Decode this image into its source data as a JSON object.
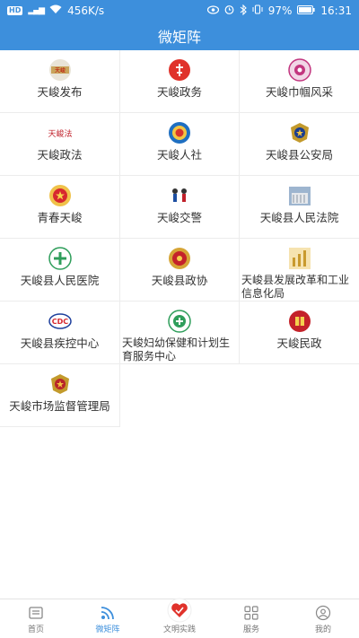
{
  "status": {
    "speed": "456K/s",
    "battery": "97%",
    "time": "16:31",
    "hd": "HD",
    "signal": "⁴ᴳ"
  },
  "header": {
    "title": "微矩阵"
  },
  "grid": [
    {
      "label": "天峻发布",
      "icon": "tianjun-fabu-logo"
    },
    {
      "label": "天峻政务",
      "icon": "zhengwu-logo"
    },
    {
      "label": "天峻巾帼风采",
      "icon": "women-federation-logo"
    },
    {
      "label": "天峻政法",
      "icon": "zhengfa-logo"
    },
    {
      "label": "天峻人社",
      "icon": "renshe-logo"
    },
    {
      "label": "天峻县公安局",
      "icon": "police-badge-logo"
    },
    {
      "label": "青春天峻",
      "icon": "youth-league-logo"
    },
    {
      "label": "天峻交警",
      "icon": "traffic-police-logo"
    },
    {
      "label": "天峻县人民法院",
      "icon": "court-building-logo"
    },
    {
      "label": "天峻县人民医院",
      "icon": "hospital-logo"
    },
    {
      "label": "天峻县政协",
      "icon": "cppcc-logo"
    },
    {
      "label": "天峻县发展改革和工业信息化局",
      "icon": "development-logo"
    },
    {
      "label": "天峻县疾控中心",
      "icon": "cdc-logo"
    },
    {
      "label": "天峻妇幼保健和计划生育服务中心",
      "icon": "maternal-health-logo"
    },
    {
      "label": "天峻民政",
      "icon": "civil-affairs-logo"
    },
    {
      "label": "天峻市场监督管理局",
      "icon": "market-supervision-logo"
    }
  ],
  "tabs": [
    {
      "label": "首页",
      "icon": "home-news-icon"
    },
    {
      "label": "微矩阵",
      "icon": "rss-icon"
    },
    {
      "label": "文明实践",
      "icon": "heart-logo-icon"
    },
    {
      "label": "服务",
      "icon": "grid-icon"
    },
    {
      "label": "我的",
      "icon": "profile-icon"
    }
  ],
  "colors": {
    "accent": "#3d8fdc",
    "label": "#333333",
    "inactive": "#777777"
  }
}
